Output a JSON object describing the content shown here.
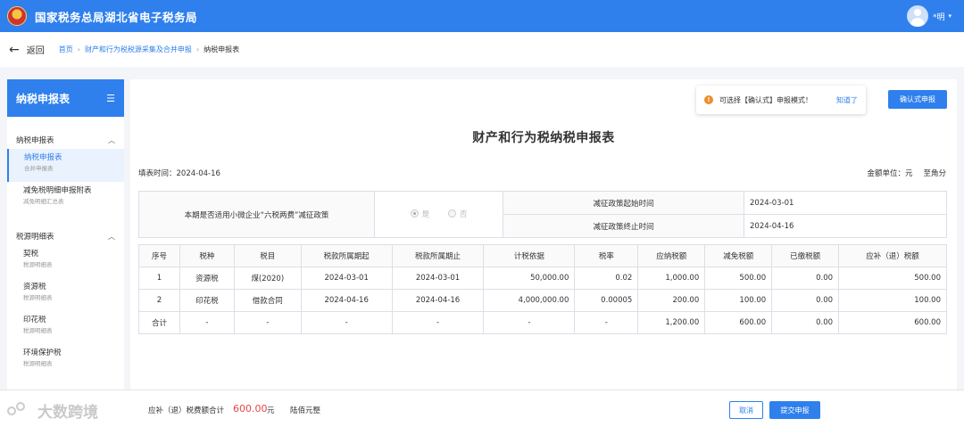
{
  "header": {
    "title": "国家税务总局湖北省电子税务局",
    "user_name": "*明",
    "user_caret": "▾"
  },
  "breadcrumb": {
    "back_label": "返回",
    "items": [
      "首页",
      "财产和行为税税源采集及合并申报",
      "纳税申报表"
    ]
  },
  "sidebar": {
    "title": "纳税申报表",
    "groups": [
      {
        "label": "纳税申报表",
        "items": [
          {
            "label": "纳税申报表",
            "sub": "合并申报表"
          },
          {
            "label": "减免税明细申报附表",
            "sub": "减免明细汇总表"
          }
        ]
      },
      {
        "label": "税源明细表",
        "items": [
          {
            "label": "契税",
            "sub": "税源明细表"
          },
          {
            "label": "资源税",
            "sub": "税源明细表"
          },
          {
            "label": "印花税",
            "sub": "税源明细表"
          },
          {
            "label": "环境保护税",
            "sub": "税源明细表"
          }
        ]
      }
    ]
  },
  "tip": {
    "text": "可选择【确认式】申报模式！",
    "link": "知道了",
    "button": "确认式申报"
  },
  "form": {
    "title": "财产和行为税纳税申报表",
    "fill_time": "填表时间：2024-04-16",
    "unit": "金额单位：元",
    "unit_precision": "至角分",
    "policy_question": "本期是否适用小微企业“六税两费”减征政策",
    "radio_yes": "是",
    "radio_no": "否",
    "start_label": "减征政策起始时间",
    "start_value": "2024-03-01",
    "end_label": "减征政策终止时间",
    "end_value": "2024-04-16"
  },
  "table": {
    "headers": [
      "序号",
      "税种",
      "税目",
      "税款所属期起",
      "税款所属期止",
      "计税依据",
      "税率",
      "应纳税额",
      "减免税额",
      "已缴税额",
      "应补（退）税额"
    ],
    "rows": [
      [
        "1",
        "资源税",
        "煤(2020)",
        "2024-03-01",
        "2024-03-01",
        "50,000.00",
        "0.02",
        "1,000.00",
        "500.00",
        "0.00",
        "500.00"
      ],
      [
        "2",
        "印花税",
        "借款合同",
        "2024-04-16",
        "2024-04-16",
        "4,000,000.00",
        "0.00005",
        "200.00",
        "100.00",
        "0.00",
        "100.00"
      ],
      [
        "合计",
        "-",
        "-",
        "-",
        "-",
        "-",
        "-",
        "1,200.00",
        "600.00",
        "0.00",
        "600.00"
      ]
    ]
  },
  "footer": {
    "watermark": "大数跨境",
    "total_label": "应补（退）税费额合计",
    "total_value": "600.00",
    "total_unit": "元",
    "total_words": "陆佰元整",
    "cancel": "取消",
    "submit": "提交申报"
  }
}
